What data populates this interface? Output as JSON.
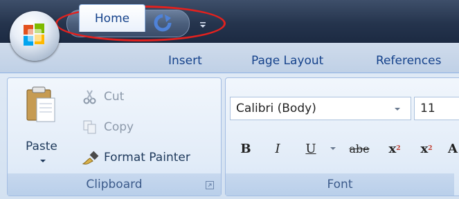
{
  "quick_access": {
    "save_icon": "save-icon",
    "undo_icon": "undo-icon",
    "undo_dropdown_icon": "chevron-down-icon",
    "redo_icon": "redo-icon",
    "customize_icon": "customize-qat-icon",
    "highlight_color": "#e3211e"
  },
  "tabs": [
    "Home",
    "Insert",
    "Page Layout",
    "References"
  ],
  "active_tab": "Home",
  "clipboard": {
    "paste_label": "Paste",
    "cut_label": "Cut",
    "copy_label": "Copy",
    "format_painter_label": "Format Painter",
    "group_label": "Clipboard"
  },
  "font": {
    "font_name": "Calibri (Body)",
    "font_size": "11",
    "bold": "B",
    "italic": "I",
    "underline": "U",
    "strikethrough": "abe",
    "subscript": "x",
    "superscript": "x",
    "grow": "A",
    "group_label": "Font"
  },
  "colors": {
    "titlebar": "#25344d",
    "tab_text": "#15428b",
    "ribbon": "#dfe9f5"
  }
}
